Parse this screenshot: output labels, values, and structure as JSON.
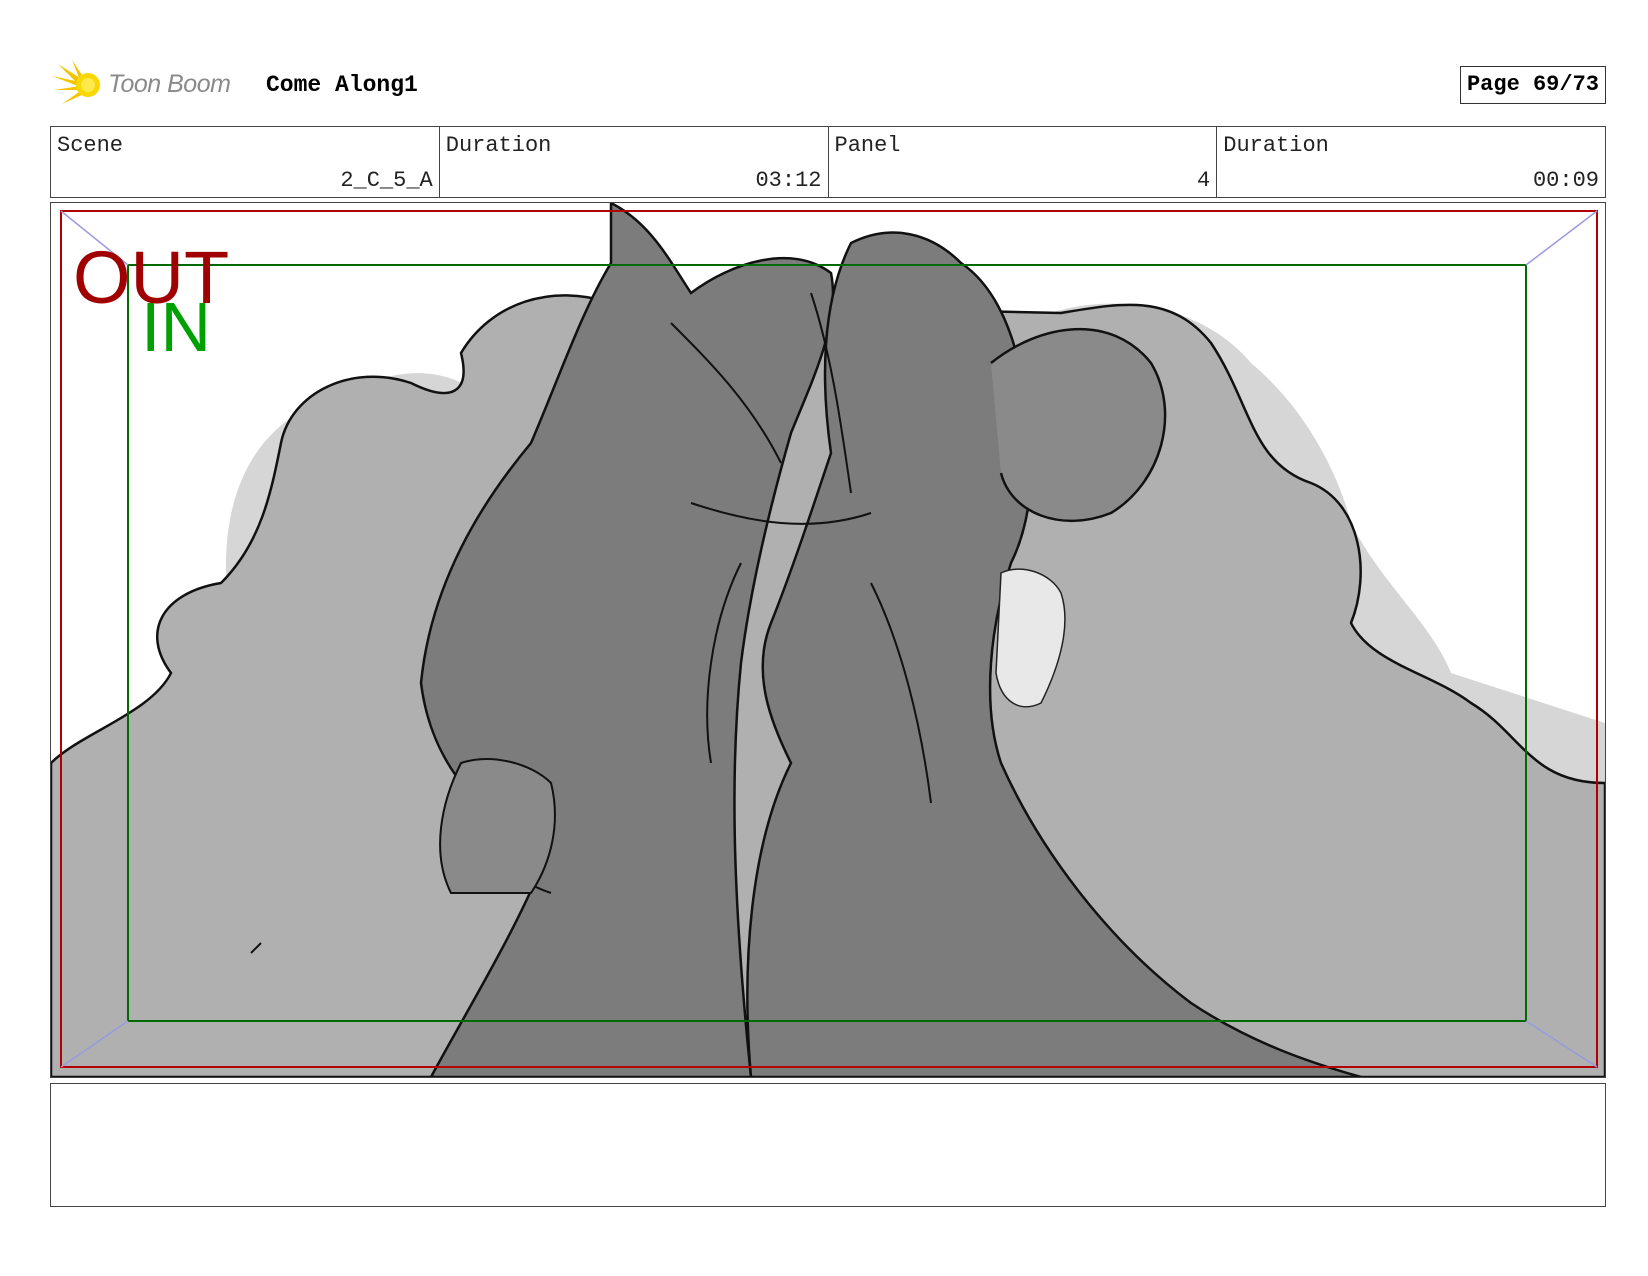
{
  "header": {
    "logo_text": "Toon Boom",
    "project_title": "Come Along1",
    "page_label": "Page 69/73"
  },
  "info": {
    "scene_label": "Scene",
    "scene_value": "2_C_5_A",
    "scene_duration_label": "Duration",
    "scene_duration_value": "03:12",
    "panel_label": "Panel",
    "panel_value": "4",
    "panel_duration_label": "Duration",
    "panel_duration_value": "00:09"
  },
  "frame_guides": {
    "out_label": "OUT",
    "in_label": "IN",
    "out_color": "#a00000",
    "in_color": "#00a000"
  },
  "notes": {
    "text": ""
  }
}
